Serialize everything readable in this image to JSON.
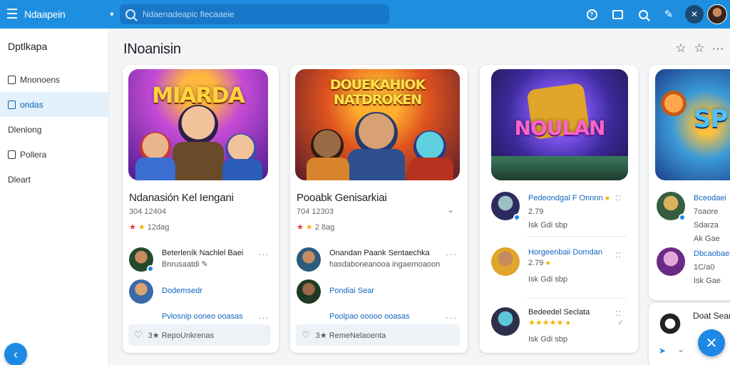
{
  "topbar": {
    "app_title": "Ndaapein",
    "search_placeholder": "Ndaenadeapic fiecaaeie",
    "icons": [
      "menu-icon",
      "caret-down-icon",
      "search-icon",
      "help-icon",
      "bookmark-icon",
      "search-icon",
      "pin-icon",
      "tools-icon"
    ]
  },
  "sidebar": {
    "heading": "Dptlkapa",
    "items": [
      {
        "label": "Mnonoens",
        "icon": "file-icon"
      },
      {
        "label": "ondas",
        "icon": "file-icon"
      },
      {
        "label": "Dlenlong",
        "icon": ""
      },
      {
        "label": "Pollera",
        "icon": "file-icon"
      },
      {
        "label": "Dleart",
        "icon": ""
      }
    ]
  },
  "main": {
    "title": "INoanisin",
    "cards": [
      {
        "art_title": "MIARDA",
        "title": "Ndanasión Kel Iengani",
        "meta": "304 12404",
        "rating": "12dag",
        "comments": [
          {
            "name": "Beterleník Nachlel Baei",
            "sub": "Bnrusaatdi"
          },
          {
            "name": "Dodemsedr",
            "sub": ""
          },
          {
            "name": "Pvlosnip ooneo ooasas",
            "sub": ""
          }
        ],
        "footer": "3★ RepoUnkrenas"
      },
      {
        "art_title": "DOUEKAHIOK NATDROKEN",
        "title": "Pooabk Genisarkiai",
        "meta": "704 12303",
        "rating": "2 8ag",
        "comments": [
          {
            "name": "Onandan Paank Sentaechka",
            "sub": "hasdaboneanooa ingaernoaoon"
          },
          {
            "name": "Pondiai Sear",
            "sub": ""
          },
          {
            "name": "Poolpao ooooo ooasas",
            "sub": ""
          }
        ],
        "footer": "3★ RemeNelaoenta"
      },
      {
        "art_title": "NOULAN",
        "comments": [
          {
            "name": "Pedeondgal F Onnnn",
            "sub": "2.79",
            "sub2": "Isk Gdi sbp"
          },
          {
            "name": "Horgeenbaii Domdan",
            "sub": "2.79",
            "sub2": "Isk Gdi sbp"
          },
          {
            "name": "Bedeedel Seclata",
            "sub": "★★★★★",
            "sub2": "Isk Gdi sbp"
          }
        ]
      },
      {
        "art_title": "SP",
        "comments": [
          {
            "name": "Bceodaei",
            "sub": "7oaore Sdarza",
            "sub2": "Ak Gae"
          },
          {
            "name": "Dbcaobaes",
            "sub": "1C/a0",
            "sub2": "Isk Gae"
          }
        ],
        "extra": "Doat Sean"
      }
    ]
  }
}
